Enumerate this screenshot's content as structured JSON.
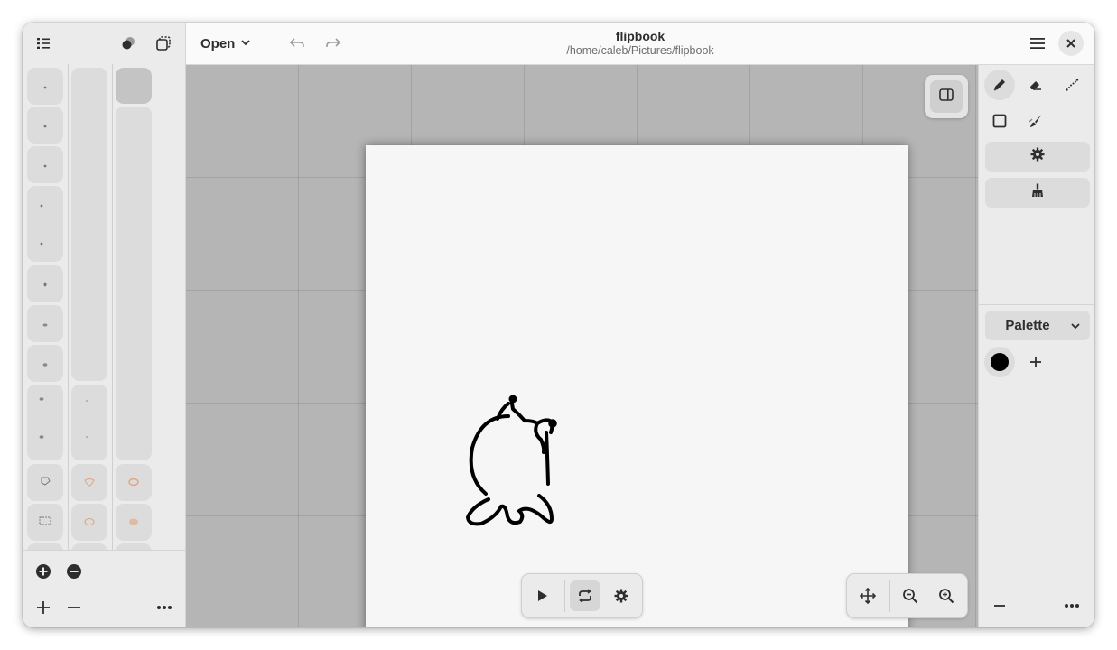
{
  "header": {
    "open_label": "Open",
    "title": "flipbook",
    "subtitle": "/home/caleb/Pictures/flipbook"
  },
  "palette": {
    "label": "Palette",
    "colors": [
      "#000000"
    ]
  },
  "colors": {
    "accent_active_tool": "#dcdcdc",
    "canvas_bg": "#b5b5b5",
    "paper": "#f6f6f6"
  },
  "icons": {
    "sidebar_top": [
      "list-icon",
      "onion-skin-icon",
      "frame-select-icon"
    ],
    "tools": [
      "pencil-icon",
      "eraser-icon",
      "dotted-line-icon",
      "rectangle-icon",
      "fill-brush-icon"
    ],
    "tool_actions": [
      "gear-icon",
      "broom-icon"
    ],
    "playback": [
      "play-icon",
      "loop-icon",
      "gear-icon"
    ],
    "view": [
      "move-icon",
      "zoom-out-icon",
      "zoom-in-icon"
    ]
  }
}
